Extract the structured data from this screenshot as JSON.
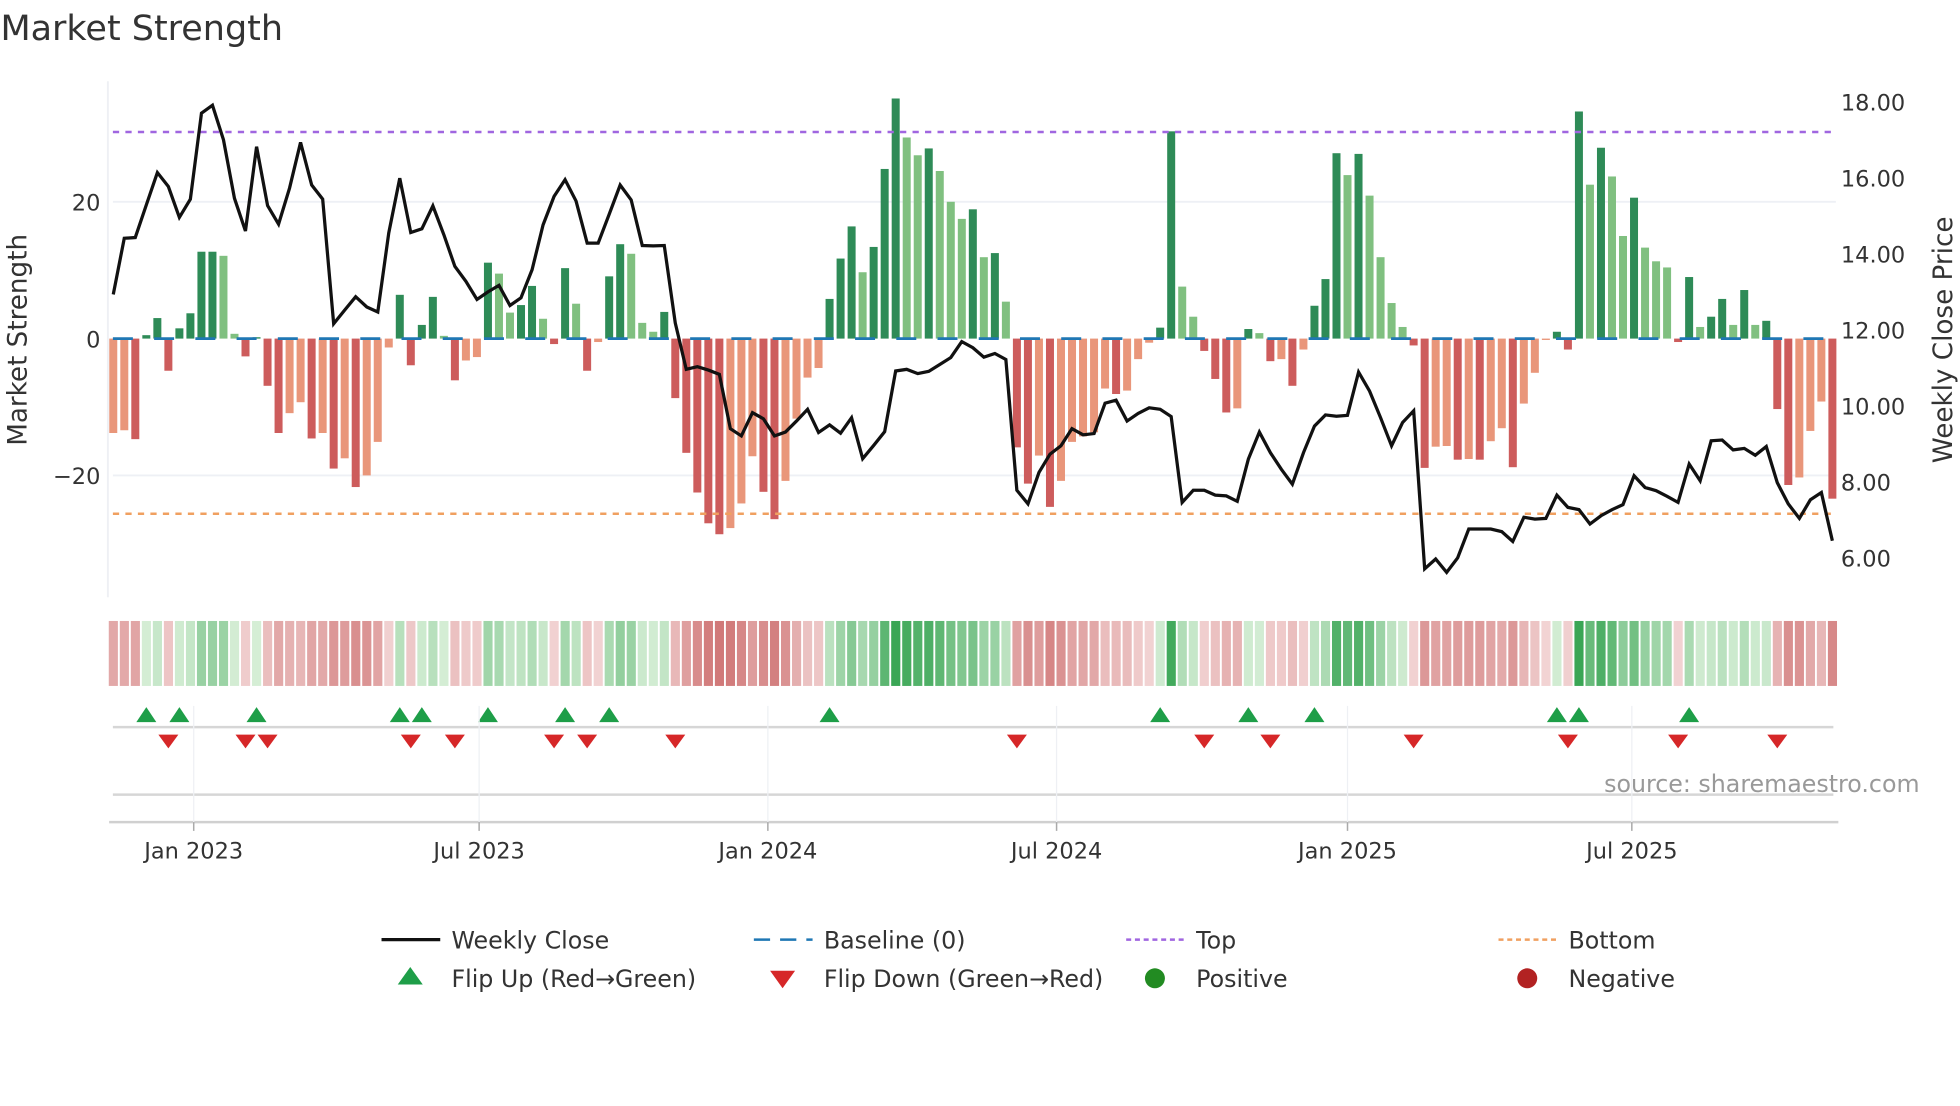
{
  "chart_data": {
    "type": "bar",
    "title": "Market Strength",
    "ylabel": "Market Strength",
    "y2label": "Weekly Close Price",
    "ylim": [
      -38,
      38
    ],
    "y2lim": [
      4.9,
      18.6
    ],
    "yticks": [
      {
        "v": 20,
        "label": "20"
      },
      {
        "v": 0,
        "label": "0"
      },
      {
        "v": -20,
        "label": "−20"
      }
    ],
    "y2ticks": [
      {
        "v": 18,
        "label": "18.00"
      },
      {
        "v": 16,
        "label": "16.00"
      },
      {
        "v": 14,
        "label": "14.00"
      },
      {
        "v": 12,
        "label": "12.00"
      },
      {
        "v": 10,
        "label": "10.00"
      },
      {
        "v": 8,
        "label": "8.00"
      },
      {
        "v": 6,
        "label": "6.00"
      }
    ],
    "xticks": [
      {
        "week": 7.3,
        "label": "Jan 2023"
      },
      {
        "week": 33.2,
        "label": "Jul 2023"
      },
      {
        "week": 59.4,
        "label": "Jan 2024"
      },
      {
        "week": 85.6,
        "label": "Jul 2024"
      },
      {
        "week": 112.0,
        "label": "Jan 2025"
      },
      {
        "week": 137.8,
        "label": "Jul 2025"
      }
    ],
    "top": 30.2,
    "bottom": -25.6,
    "baseline": 0,
    "strength": [
      -13.8,
      -13.4,
      -14.7,
      0.5,
      3.0,
      -4.7,
      1.5,
      3.7,
      12.7,
      12.7,
      12.1,
      0.7,
      -2.6,
      0.2,
      -6.9,
      -13.8,
      -10.9,
      -9.3,
      -14.6,
      -13.8,
      -19.0,
      -17.5,
      -21.7,
      -20.0,
      -15.1,
      -1.3,
      6.4,
      -3.9,
      2.0,
      6.1,
      0.4,
      -6.1,
      -3.2,
      -2.7,
      11.1,
      9.5,
      3.8,
      4.9,
      7.7,
      2.9,
      -0.8,
      10.3,
      5.1,
      -4.7,
      -0.5,
      9.1,
      13.8,
      12.4,
      2.3,
      1.0,
      3.9,
      -8.7,
      -16.7,
      -22.5,
      -27.0,
      -28.6,
      -27.7,
      -24.1,
      -17.2,
      -22.4,
      -26.4,
      -20.8,
      -11.7,
      -5.7,
      -4.3,
      5.8,
      11.7,
      16.4,
      9.7,
      13.4,
      24.8,
      35.1,
      29.4,
      26.8,
      27.8,
      24.5,
      20.0,
      17.5,
      18.9,
      11.9,
      12.5,
      5.4,
      -15.9,
      -21.2,
      -17.1,
      -24.6,
      -20.8,
      -15.1,
      -14.3,
      -13.7,
      -7.3,
      -8.1,
      -7.6,
      -3.0,
      -0.6,
      1.6,
      30.3,
      7.6,
      3.2,
      -1.8,
      -5.9,
      -10.8,
      -10.2,
      1.4,
      0.8,
      -3.3,
      -3.0,
      -6.9,
      -1.6,
      4.8,
      8.7,
      27.1,
      23.9,
      27.0,
      20.9,
      11.9,
      5.2,
      1.7,
      -1.0,
      -18.9,
      -15.8,
      -15.7,
      -17.7,
      -17.6,
      -17.7,
      -15.0,
      -13.1,
      -18.8,
      -9.5,
      -5.0,
      -0.2,
      1.0,
      -1.6,
      33.2,
      22.5,
      27.9,
      23.7,
      15.0,
      20.6,
      13.3,
      11.3,
      10.4,
      -0.5,
      9.0,
      1.7,
      3.2,
      5.8,
      2.0,
      7.1,
      2.0,
      2.6,
      -10.3,
      -21.4,
      -20.3,
      -13.5,
      -9.2,
      -23.4
    ],
    "weekly_close": [
      12.93,
      14.41,
      14.43,
      15.29,
      16.14,
      15.77,
      14.96,
      15.44,
      17.7,
      17.91,
      17.0,
      15.46,
      14.6,
      16.82,
      15.27,
      14.78,
      15.73,
      16.93,
      15.81,
      15.44,
      12.16,
      12.52,
      12.87,
      12.6,
      12.47,
      14.55,
      15.99,
      14.56,
      14.66,
      15.26,
      14.5,
      13.67,
      13.28,
      12.8,
      13.0,
      13.17,
      12.64,
      12.84,
      13.58,
      14.76,
      15.51,
      15.95,
      15.39,
      14.28,
      14.28,
      15.04,
      15.81,
      15.42,
      14.22,
      14.21,
      14.22,
      12.18,
      10.96,
      11.03,
      10.94,
      10.83,
      9.4,
      9.21,
      9.82,
      9.66,
      9.21,
      9.31,
      9.6,
      9.91,
      9.3,
      9.5,
      9.28,
      9.69,
      8.61,
      8.96,
      9.32,
      10.92,
      10.96,
      10.85,
      10.91,
      11.09,
      11.27,
      11.69,
      11.53,
      11.28,
      11.38,
      11.22,
      7.78,
      7.42,
      8.25,
      8.73,
      8.95,
      9.4,
      9.24,
      9.27,
      10.07,
      10.15,
      9.6,
      9.8,
      9.95,
      9.91,
      9.72,
      7.46,
      7.78,
      7.78,
      7.65,
      7.63,
      7.49,
      8.6,
      9.31,
      8.77,
      8.33,
      7.94,
      8.77,
      9.47,
      9.76,
      9.73,
      9.75,
      10.89,
      10.39,
      9.69,
      8.95,
      9.56,
      9.87,
      5.71,
      5.97,
      5.62,
      6.0,
      6.76,
      6.76,
      6.76,
      6.69,
      6.43,
      7.07,
      7.02,
      7.04,
      7.65,
      7.33,
      7.27,
      6.89,
      7.11,
      7.27,
      7.4,
      8.16,
      7.85,
      7.77,
      7.62,
      7.46,
      8.47,
      8.03,
      9.08,
      9.1,
      8.84,
      8.88,
      8.7,
      8.93,
      7.98,
      7.42,
      7.04,
      7.53,
      7.72,
      6.45
    ],
    "flip_up_weeks": [
      3,
      6,
      13,
      26,
      28,
      34,
      41,
      45,
      65,
      95,
      103,
      109,
      131,
      133,
      143
    ],
    "flip_down_weeks": [
      5,
      12,
      14,
      27,
      31,
      40,
      43,
      51,
      82,
      99,
      105,
      118,
      132,
      142,
      151
    ],
    "legend": [
      {
        "key": "close",
        "label": "Weekly Close"
      },
      {
        "key": "baseline",
        "label": "Baseline (0)"
      },
      {
        "key": "top",
        "label": "Top"
      },
      {
        "key": "bottom",
        "label": "Bottom"
      },
      {
        "key": "flipup",
        "label": "Flip Up (Red→Green)"
      },
      {
        "key": "flipdown",
        "label": "Flip Down (Green→Red)"
      },
      {
        "key": "positive",
        "label": "Positive"
      },
      {
        "key": "negative",
        "label": "Negative"
      }
    ],
    "legend_placement": "bottom",
    "source": "source: sharemaestro.com"
  },
  "colors": {
    "pos_rising": "#2e8b57",
    "pos_falling": "#80c080",
    "neg_falling": "#cd5c5c",
    "neg_rising": "#e9967a",
    "baseline": "#1f77b4",
    "top": "#a066e0",
    "bottom": "#f0a060",
    "flip_up": "#1e9e48",
    "flip_down": "#d62728",
    "positive": "#228b22",
    "negative": "#b22222"
  }
}
